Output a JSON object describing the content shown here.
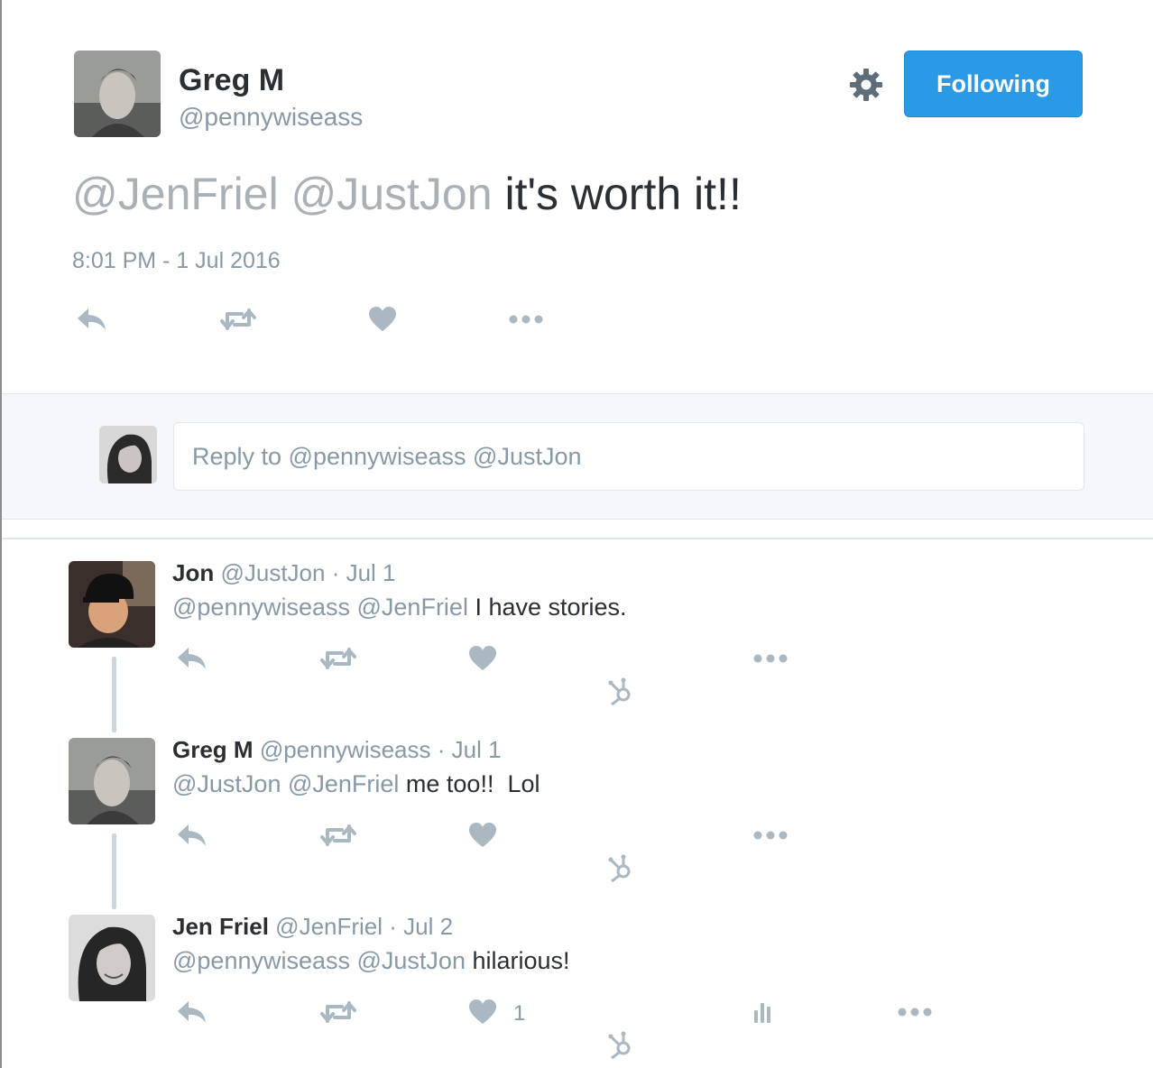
{
  "colors": {
    "accent": "#2b9ae6",
    "muted": "#8899a6",
    "icon": "#aab8c2",
    "text": "#292f33"
  },
  "main_tweet": {
    "author_name": "Greg M",
    "author_handle": "@pennywiseass",
    "follow_button": "Following",
    "settings_icon": "gear-icon",
    "text_mentions": "@JenFriel @JustJon",
    "text_body": " it's worth it!!",
    "timestamp": "8:01 PM - 1 Jul 2016",
    "actions": [
      "reply-icon",
      "retweet-icon",
      "heart-icon",
      "more-icon"
    ]
  },
  "reply_box": {
    "placeholder": "Reply to @pennywiseass @JustJon"
  },
  "replies": [
    {
      "name": "Jon",
      "handle": "@JustJon",
      "date": "· Jul 1",
      "mentions": "@pennywiseass @JenFriel",
      "text": " I have stories.",
      "like_count": ""
    },
    {
      "name": "Greg M",
      "handle": "@pennywiseass",
      "date": "· Jul 1",
      "mentions": "@JustJon @JenFriel",
      "text": " me too!!  Lol",
      "like_count": ""
    },
    {
      "name": "Jen Friel",
      "handle": "@JenFriel",
      "date": "· Jul 2",
      "mentions": "@pennywiseass @JustJon",
      "text": " hilarious!",
      "like_count": "1"
    }
  ]
}
